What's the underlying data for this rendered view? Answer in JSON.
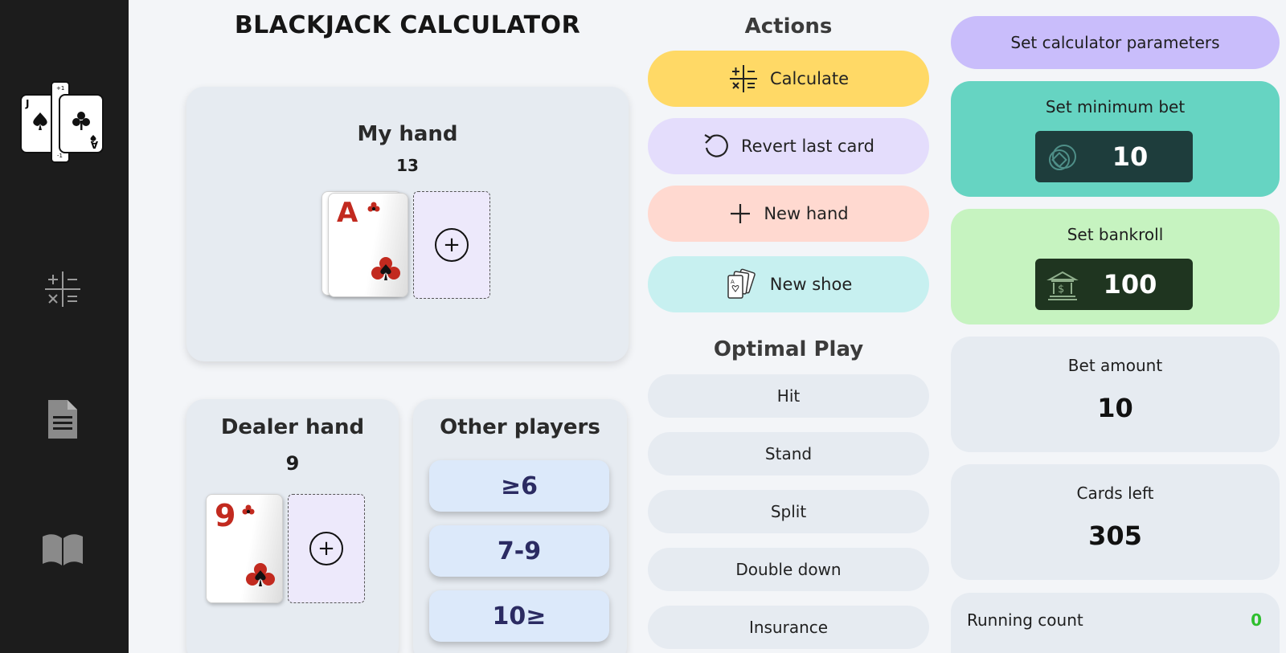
{
  "app": {
    "title": "BLACKJACK CALCULATOR"
  },
  "sidebar": {
    "items": [
      {
        "icon": "calculator-icon"
      },
      {
        "icon": "document-icon"
      },
      {
        "icon": "book-icon"
      }
    ]
  },
  "my_hand": {
    "title": "My hand",
    "total": "13",
    "cards": [
      {
        "rank": "A",
        "suit": "clubs"
      }
    ]
  },
  "dealer_hand": {
    "title": "Dealer hand",
    "total": "9",
    "cards": [
      {
        "rank": "9",
        "suit": "clubs"
      }
    ]
  },
  "other_players": {
    "title": "Other players",
    "buttons": [
      "≥6",
      "7-9",
      "10≥"
    ]
  },
  "actions": {
    "title": "Actions",
    "calculate": "Calculate",
    "revert": "Revert last card",
    "new_hand": "New hand",
    "new_shoe": "New shoe"
  },
  "optimal_play": {
    "title": "Optimal Play",
    "options": [
      "Hit",
      "Stand",
      "Split",
      "Double down",
      "Insurance"
    ]
  },
  "parameters": {
    "button": "Set calculator parameters",
    "min_bet_label": "Set minimum bet",
    "min_bet_value": "10",
    "bankroll_label": "Set bankroll",
    "bankroll_value": "100",
    "bet_amount_label": "Bet amount",
    "bet_amount_value": "10",
    "cards_left_label": "Cards left",
    "cards_left_value": "305",
    "running_count_label": "Running count",
    "running_count_value": "0"
  },
  "colors": {
    "calculate": "#ffd966",
    "revert": "#e4ddfc",
    "new_hand": "#ffd9d0",
    "new_shoe": "#c7f0f0",
    "params_button": "#c9bdfb",
    "min_bet_bg": "#66d4c2",
    "min_bet_field": "#1e3d3c",
    "bankroll_bg": "#c6f3c0",
    "bankroll_field": "#1f3520",
    "running_count": "#2fbf2f"
  }
}
